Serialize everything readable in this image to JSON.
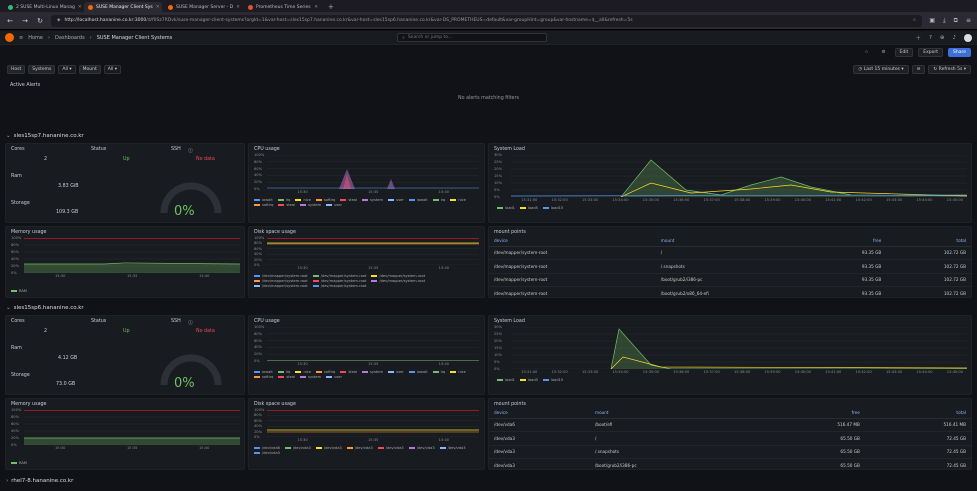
{
  "browser": {
    "tabs": [
      {
        "label": "2 SUSE Multi-Linux Manag",
        "color": "#30ba78",
        "active": false
      },
      {
        "label": "SUSE Manager Client Sys",
        "color": "#f46800",
        "active": true
      },
      {
        "label": "SUSE Manager Server - D",
        "color": "#f46800",
        "active": false
      },
      {
        "label": "Prometheus Time Series",
        "color": "#e6522c",
        "active": false
      }
    ],
    "url_host": "http://localhost.hananine.co.kr:3000",
    "url_rest": "/d/f0Sz7RDvk/suse-manager-client-systems?orgId=1&var-host=sles15sp7.hananine.co.kr&var-host=sles15sp6.hananine.co.kr&var-DS_PROMETHEUS=default&var-groupHint=group&var-hostname=$__all&refresh=5s"
  },
  "grafana": {
    "home": "Home",
    "dashboards": "Dashboards",
    "dashboard_title": "SUSE Manager Client Systems",
    "search_placeholder": "Search or jump to...",
    "edit": "Edit",
    "export": "Export",
    "share": "Share",
    "time_range": "Last 15 minutes",
    "refresh": "Refresh",
    "refresh_interval": "5s"
  },
  "variables": {
    "host_label": "Host",
    "systems_label": "Systems",
    "systems_value": "All",
    "mount_label": "Mount",
    "mount_value": "All"
  },
  "active_alerts": {
    "title": "Active Alerts",
    "empty": "No alerts matching filters"
  },
  "rows": [
    {
      "name": "sles15sp7.hananine.co.kr",
      "cores_label": "Cores",
      "cores": "2",
      "status_label": "Status",
      "status": "Up",
      "ssh_label": "SSH",
      "ssh": "No data",
      "ram_label": "Ram",
      "ram": "3.83 GiB",
      "storage_label": "Storage",
      "storage": "109.3 GB",
      "gauge": "0%",
      "cpu_title": "CPU usage",
      "load_title": "System Load",
      "mem_title": "Memory usage",
      "disk_title": "Disk space usage",
      "mp_title": "mount points",
      "mp_headers": [
        "device",
        "mount",
        "free",
        "total"
      ],
      "mp_rows": [
        [
          "/dev/mapper/system-root",
          "/",
          "93.35 GB",
          "102.72 GB"
        ],
        [
          "/dev/mapper/system-root",
          "/.snapshots",
          "93.35 GB",
          "102.72 GB"
        ],
        [
          "/dev/mapper/system-root",
          "/boot/grub2/i386-pc",
          "93.35 GB",
          "102.72 GB"
        ],
        [
          "/dev/mapper/system-root",
          "/boot/grub2/x86_64-efi",
          "93.35 GB",
          "102.72 GB"
        ]
      ]
    },
    {
      "name": "sles15sp6.hananine.co.kr",
      "cores_label": "Cores",
      "cores": "2",
      "status_label": "Status",
      "status": "Up",
      "ssh_label": "SSH",
      "ssh": "No data",
      "ram_label": "Ram",
      "ram": "4.12 GB",
      "storage_label": "Storage",
      "storage": "73.0 GB",
      "gauge": "0%",
      "cpu_title": "CPU usage",
      "load_title": "System Load",
      "mem_title": "Memory usage",
      "disk_title": "Disk space usage",
      "mp_title": "mount points",
      "mp_headers": [
        "device",
        "mount",
        "free",
        "total"
      ],
      "mp_rows": [
        [
          "/dev/vda6",
          "/boot/efi",
          "516.47 MB",
          "516.41 MB"
        ],
        [
          "/dev/vda3",
          "/",
          "65.50 GB",
          "72.45 GB"
        ],
        [
          "/dev/vda3",
          "/.snapshots",
          "65.50 GB",
          "72.45 GB"
        ],
        [
          "/dev/vda3",
          "/boot/grub2/i386-pc",
          "65.50 GB",
          "72.45 GB"
        ]
      ]
    }
  ],
  "next_row": "rhel7-8.hananine.co.kr",
  "cpu_y": [
    "100%",
    "80%",
    "60%",
    "40%",
    "20%",
    "0%"
  ],
  "cpu_x": [
    "15:30",
    "15:35",
    "15:40"
  ],
  "cpu_legend": [
    "iowait",
    "irq",
    "nice",
    "softirq",
    "steal",
    "system",
    "user",
    "iowait",
    "irq",
    "nice",
    "softirq",
    "steal",
    "system",
    "user"
  ],
  "load_y": [
    "30%",
    "25%",
    "20%",
    "15%",
    "10%",
    "5%",
    "0%"
  ],
  "load_x": [
    "15:31:00",
    "15:32:00",
    "15:33:00",
    "15:34:00",
    "15:35:00",
    "15:36:00",
    "15:37:00",
    "15:38:00",
    "15:39:00",
    "15:40:00",
    "15:41:00",
    "15:42:00",
    "15:43:00",
    "15:44:00",
    "15:45:00"
  ],
  "load_legend": [
    "load1",
    "load5",
    "load15"
  ],
  "mem_y": [
    "100%",
    "80%",
    "60%",
    "40%",
    "20%",
    "0%"
  ],
  "mem_x": [
    "15:30",
    "15:35",
    "15:40"
  ],
  "mem_legend": "RAM",
  "disk_y": [
    "100%",
    "80%",
    "60%",
    "40%",
    "20%",
    "0%"
  ],
  "disk_x": [
    "15:30",
    "15:35",
    "15:40"
  ],
  "disk_legend_1": [
    "/dev/mapper/system-root",
    "/dev/mapper/system-root",
    "/dev/mapper/system-root",
    "/dev/mapper/system-root",
    "/dev/mapper/system-root",
    "/dev/mapper/system-root",
    "/dev/mapper/system-root",
    "/dev/mapper/system-root"
  ],
  "disk_legend_2": [
    "/dev/vda6",
    "/dev/vda3",
    "/dev/vda3",
    "/dev/vda3",
    "/dev/vda3",
    "/dev/vda3",
    "/dev/vda3",
    "/dev/vda3"
  ],
  "colors": {
    "green": "#73bf69",
    "yellow": "#fade2a",
    "blue": "#5794f2",
    "red": "#f2495c",
    "purple": "#b877d9",
    "orange": "#ff9830",
    "cyan": "#8ab8ff"
  }
}
